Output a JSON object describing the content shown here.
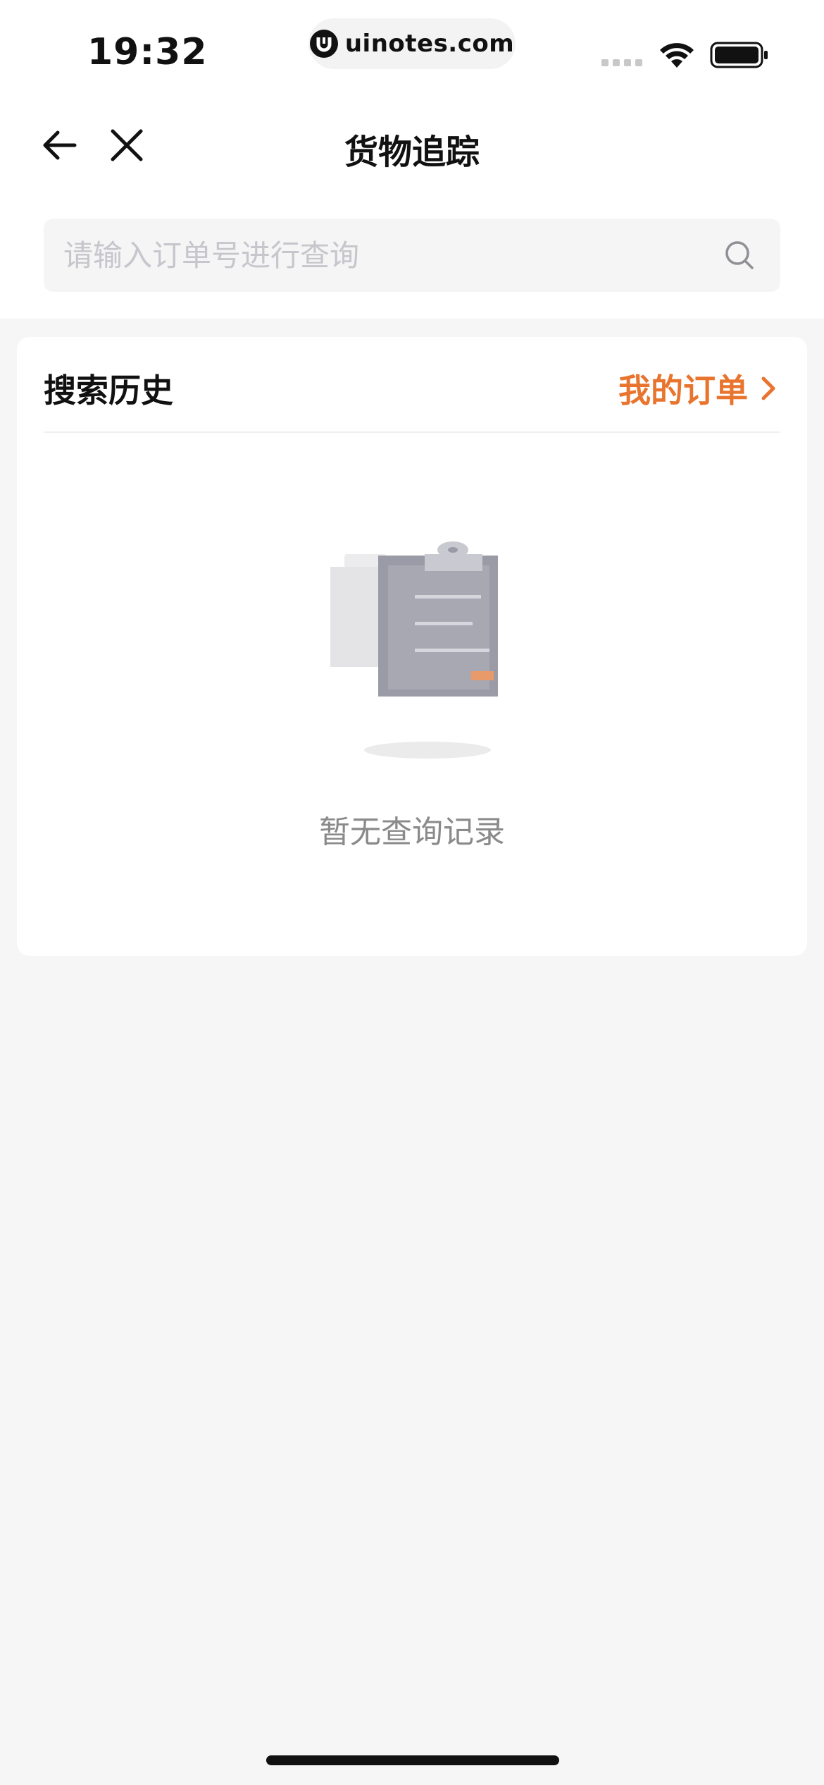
{
  "status_bar": {
    "time": "19:32",
    "url": "uinotes.com",
    "icons": [
      "signal-icon",
      "wifi-icon",
      "battery-icon"
    ]
  },
  "nav": {
    "title": "货物追踪",
    "back_icon": "back-arrow-icon",
    "close_icon": "close-icon"
  },
  "search": {
    "placeholder": "请输入订单号进行查询",
    "value": "",
    "icon": "search-icon"
  },
  "history": {
    "title": "搜索历史",
    "my_orders_label": "我的订单",
    "empty_text": "暂无查询记录",
    "empty_icon": "clipboard-icon"
  },
  "colors": {
    "accent": "#e8742e",
    "background": "#f6f6f6",
    "card": "#ffffff",
    "placeholder": "#c6c6cc"
  }
}
